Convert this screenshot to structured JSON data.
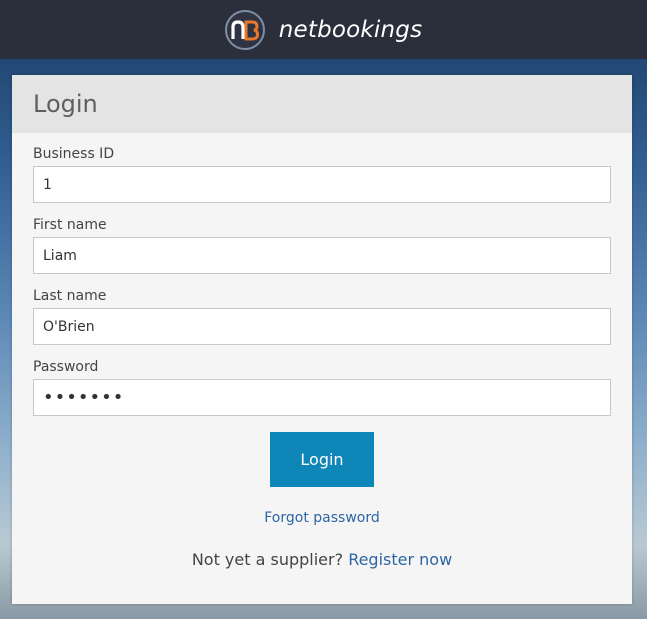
{
  "header": {
    "logo_text": "nB",
    "brand": "netbookings"
  },
  "login": {
    "title": "Login",
    "fields": [
      {
        "label": "Business ID",
        "value": "1"
      },
      {
        "label": "First name",
        "value": "Liam"
      },
      {
        "label": "Last name",
        "value": "O'Brien"
      },
      {
        "label": "Password",
        "value": "•••••••"
      }
    ],
    "submit_label": "Login",
    "forgot_label": "Forgot password",
    "register_prompt": "Not yet a supplier?",
    "register_link": "Register now"
  },
  "colors": {
    "topbar": "#2b2f3c",
    "accent": "#0f86b8",
    "link": "#2d66a3",
    "logo_orange": "#e8782a"
  }
}
